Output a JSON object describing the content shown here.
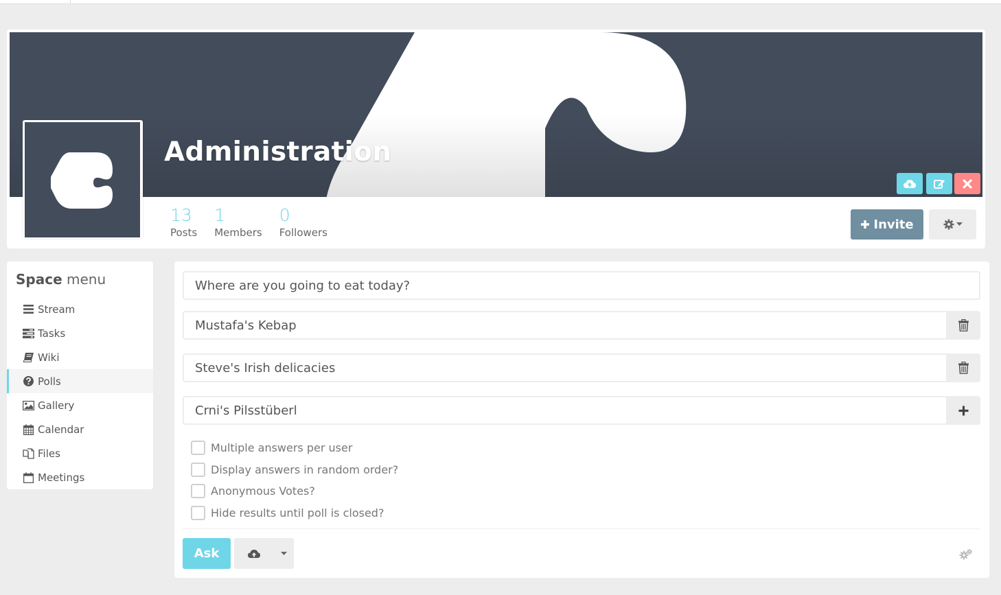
{
  "space": {
    "name": "Administration"
  },
  "stats": [
    {
      "value": "13",
      "label": "Posts"
    },
    {
      "value": "1",
      "label": "Members"
    },
    {
      "value": "0",
      "label": "Followers"
    }
  ],
  "header_actions": {
    "invite_label": "Invite"
  },
  "menu": {
    "title_bold": "Space",
    "title_light": "menu",
    "items": [
      {
        "label": "Stream",
        "icon": "bars-icon"
      },
      {
        "label": "Tasks",
        "icon": "tasks-icon"
      },
      {
        "label": "Wiki",
        "icon": "book-icon"
      },
      {
        "label": "Polls",
        "icon": "question-circle-icon",
        "active": true
      },
      {
        "label": "Gallery",
        "icon": "image-icon"
      },
      {
        "label": "Calendar",
        "icon": "calendar-icon"
      },
      {
        "label": "Files",
        "icon": "files-icon"
      },
      {
        "label": "Meetings",
        "icon": "calendar-blank-icon"
      }
    ]
  },
  "poll_form": {
    "question": "Where are you going to eat today?",
    "answers": [
      {
        "value": "Mustafa's Kebap",
        "action": "delete"
      },
      {
        "value": "Steve's Irish delicacies",
        "action": "delete"
      },
      {
        "value": "Crni's Pilsstüberl",
        "action": "add"
      }
    ],
    "options": [
      {
        "label": "Multiple answers per user",
        "checked": false
      },
      {
        "label": "Display answers in random order?",
        "checked": false
      },
      {
        "label": "Anonymous Votes?",
        "checked": false
      },
      {
        "label": "Hide results until poll is closed?",
        "checked": false
      }
    ],
    "submit_label": "Ask"
  },
  "colors": {
    "accent": "#6fd6e8",
    "danger": "#ff8989",
    "invite": "#708fa0",
    "banner": "#434c5b"
  }
}
